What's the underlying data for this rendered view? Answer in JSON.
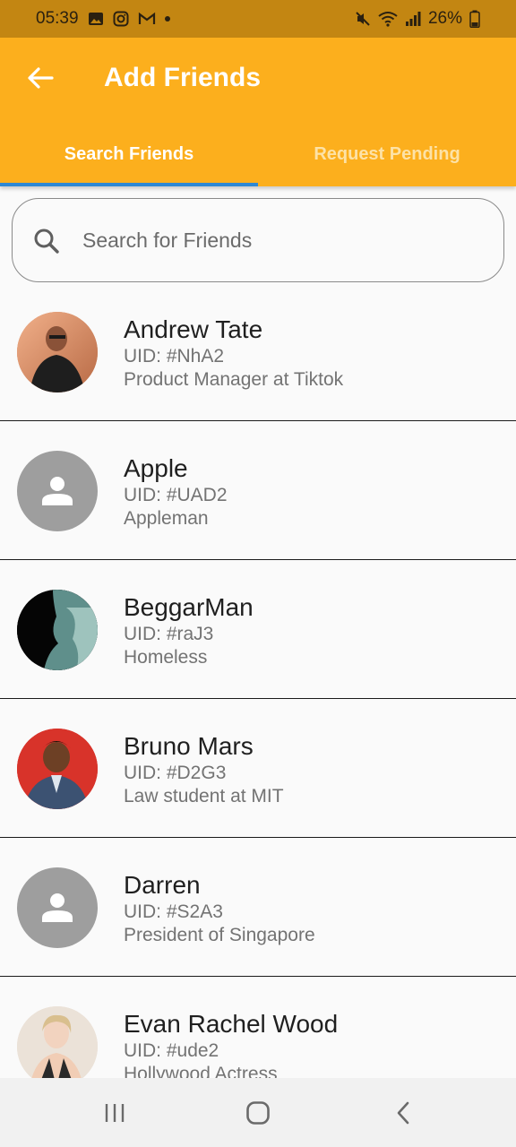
{
  "status_bar": {
    "time": "05:39",
    "battery": "26%",
    "left_icons": [
      "gallery-icon",
      "instagram-icon",
      "gmail-icon",
      "dot-icon"
    ],
    "right_icons": [
      "mute-icon",
      "wifi-icon",
      "signal-icon",
      "battery-icon"
    ]
  },
  "header": {
    "title": "Add Friends",
    "back_icon": "arrow-left-icon"
  },
  "tabs": [
    {
      "label": "Search Friends",
      "active": true
    },
    {
      "label": "Request Pending",
      "active": false
    }
  ],
  "search": {
    "placeholder": "Search for Friends",
    "value": ""
  },
  "friends": [
    {
      "name": "Andrew Tate",
      "uid": "UID: #NhA2",
      "description": "Product Manager at Tiktok",
      "avatar": "photo"
    },
    {
      "name": "Apple",
      "uid": "UID: #UAD2",
      "description": "Appleman",
      "avatar": "person-icon"
    },
    {
      "name": "BeggarMan",
      "uid": "UID: #raJ3",
      "description": "Homeless",
      "avatar": "photo"
    },
    {
      "name": "Bruno Mars",
      "uid": "UID: #D2G3",
      "description": "Law student at MIT",
      "avatar": "photo"
    },
    {
      "name": "Darren",
      "uid": "UID: #S2A3",
      "description": "President of Singapore",
      "avatar": "person-icon"
    },
    {
      "name": "Evan Rachel Wood",
      "uid": "UID: #ude2",
      "description": "Hollywood Actress",
      "avatar": "photo"
    }
  ],
  "colors": {
    "app_bar": "#fcaf1d",
    "status_bar": "#c38612",
    "tab_indicator": "#2e88d4",
    "default_avatar": "#9e9e9e"
  },
  "nav": {
    "icons": [
      "recent-apps-icon",
      "home-icon",
      "back-icon"
    ]
  }
}
